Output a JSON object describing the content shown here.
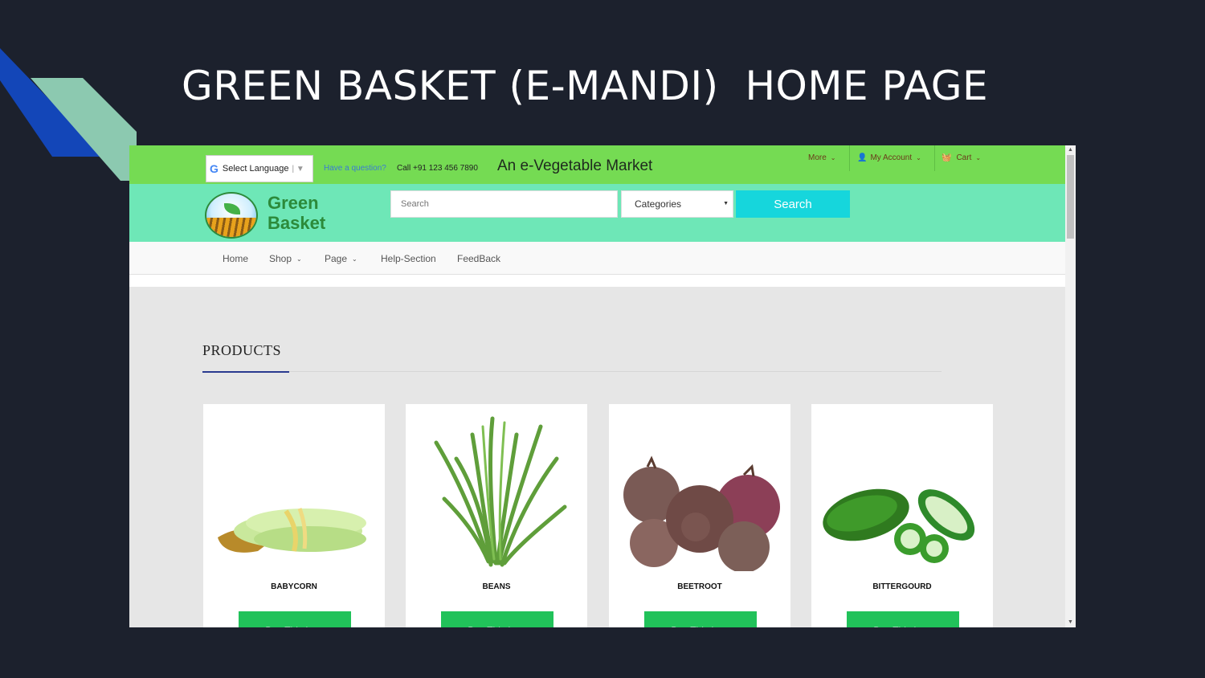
{
  "slide": {
    "title": "GREEN BASKET (E-MANDI)  HOME PAGE"
  },
  "topbar": {
    "language_label": "Select Language",
    "question": "Have a question?",
    "phone": "Call +91 123 456 7890",
    "tagline": "An e-Vegetable Market",
    "menu": [
      {
        "label": "More"
      },
      {
        "label": "My Account"
      },
      {
        "label": "Cart"
      }
    ]
  },
  "header": {
    "logo_line1": "Green",
    "logo_line2": "Basket",
    "search_placeholder": "Search",
    "category_selected": "Categories",
    "search_button": "Search"
  },
  "nav": {
    "items": [
      {
        "label": "Home"
      },
      {
        "label": "Shop"
      },
      {
        "label": "Page"
      },
      {
        "label": "Help-Section"
      },
      {
        "label": "FeedBack"
      }
    ]
  },
  "products": {
    "heading": "PRODUCTS",
    "items": [
      {
        "name": "BABYCORN",
        "button": "Buy This Item"
      },
      {
        "name": "BEANS",
        "button": "Buy This Item"
      },
      {
        "name": "BEETROOT",
        "button": "Buy This Item"
      },
      {
        "name": "BITTERGOURD",
        "button": "Buy This Item"
      }
    ]
  },
  "colors": {
    "slide_bg": "#1c212d",
    "topbar": "#75db53",
    "header": "#6ee7b7",
    "search_button": "#16d6dc",
    "buy_button": "#21c25a"
  }
}
